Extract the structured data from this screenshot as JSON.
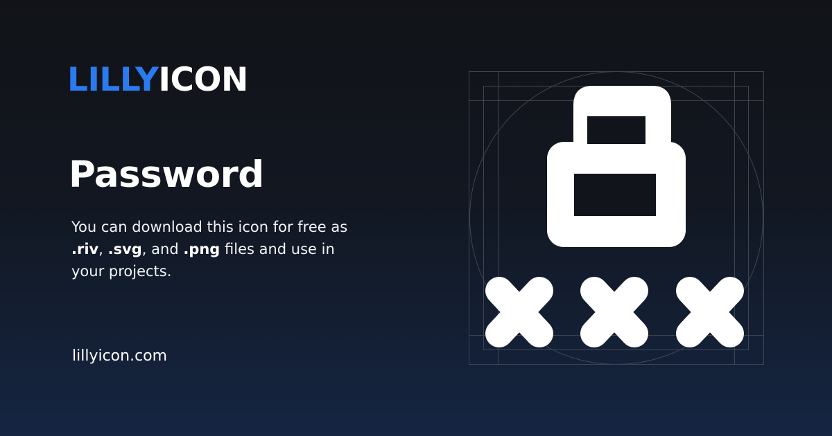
{
  "brand": {
    "logo_part1": "LILLY",
    "logo_part2": "ICON",
    "accent_color": "#2b7bf0",
    "text_color": "#ffffff"
  },
  "icon": {
    "title": "Password",
    "preview_icon": "password-icon"
  },
  "description": {
    "text_before": "You can download this icon for free as ",
    "format1": ".riv",
    "sep1": ", ",
    "format2": ".svg",
    "sep2": ", and ",
    "format3": ".png",
    "text_after": " files and use in your projects."
  },
  "footer": {
    "site": "lillyicon.com"
  }
}
